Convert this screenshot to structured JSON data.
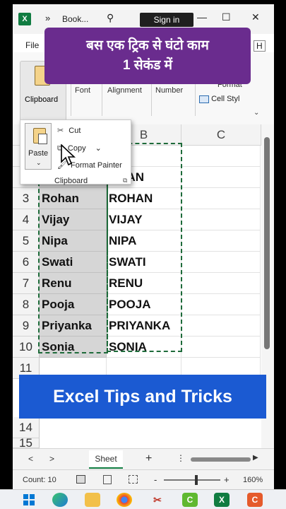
{
  "titlebar": {
    "app_icon": "X",
    "more": "»",
    "title": "Book...",
    "search_icon": "⚲",
    "signin": "Sign in",
    "minimize": "—",
    "restore": "☐",
    "close": "✕"
  },
  "menu": {
    "file": "File",
    "overflow": "H"
  },
  "banner_hi": {
    "line1": "बस एक ट्रिक से घंटो काम",
    "line2": "1 सेकंड में"
  },
  "ribbon": {
    "clipboard": "Clipboard",
    "font": "Font",
    "alignment": "Alignment",
    "number": "Number",
    "format": "Format",
    "cell_styles": "Cell Styl",
    "chevron": "⌄"
  },
  "clipboard_popup": {
    "paste": "Paste",
    "paste_chevron": "⌄",
    "cut": "Cut",
    "copy": "Copy",
    "copy_chevron": "⌄",
    "format_painter": "Format Painter",
    "group": "Clipboard",
    "launcher": "⧉"
  },
  "columns": [
    "B",
    "C"
  ],
  "rows": [
    {
      "num": "",
      "a": "",
      "b": "IT"
    },
    {
      "num": "",
      "a": "",
      "b": "OHAN"
    },
    {
      "num": "3",
      "a": "Rohan",
      "b": "ROHAN"
    },
    {
      "num": "4",
      "a": "Vijay",
      "b": "VIJAY"
    },
    {
      "num": "5",
      "a": "Nipa",
      "b": "NIPA"
    },
    {
      "num": "6",
      "a": "Swati",
      "b": "SWATI"
    },
    {
      "num": "7",
      "a": "Renu",
      "b": "RENU"
    },
    {
      "num": "8",
      "a": "Pooja",
      "b": "POOJA"
    },
    {
      "num": "9",
      "a": "Priyanka",
      "b": "PRIYANKA"
    },
    {
      "num": "10",
      "a": "Sonia",
      "b": "SONIA"
    },
    {
      "num": "11",
      "a": "",
      "b": ""
    }
  ],
  "rows_after_banner": [
    "14",
    "15"
  ],
  "bottom_banner": "Excel Tips and Tricks",
  "tabs": {
    "prev": "<",
    "next": ">",
    "sheet": "Sheet",
    "add": "+",
    "menu": "⋮",
    "right": "▶"
  },
  "status": {
    "count": "Count: 10",
    "zoom_minus": "-",
    "zoom_plus": "+",
    "zoom": "160%"
  },
  "accent_color": "#107c41",
  "banner_color": "#6a2c8e",
  "tip_color": "#1b5ad2"
}
